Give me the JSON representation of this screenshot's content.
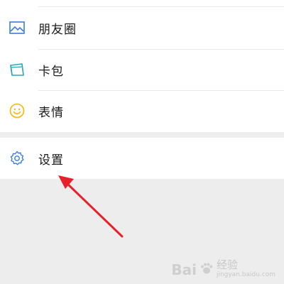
{
  "menu": {
    "items": [
      {
        "label": "朋友圈",
        "icon": "image-icon",
        "color": "#3d7fd6"
      },
      {
        "label": "卡包",
        "icon": "card-icon",
        "color": "#2aa7b8"
      },
      {
        "label": "表情",
        "icon": "smiley-icon",
        "color": "#f2b705"
      }
    ],
    "settings": {
      "label": "设置",
      "icon": "gear-icon",
      "color": "#3d7fd6"
    }
  },
  "annotation": {
    "color": "#e8202a"
  },
  "watermark": {
    "brand": "Bai",
    "name": "经验",
    "url": "jingyan.baidu.com"
  }
}
